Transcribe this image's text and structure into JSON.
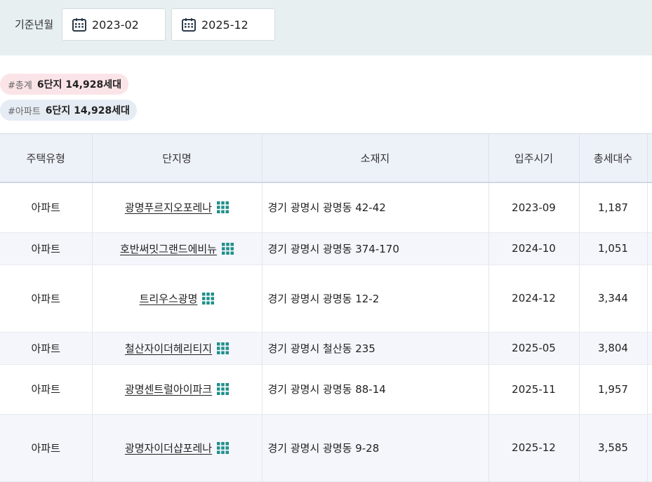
{
  "filter": {
    "label": "기준년월",
    "from": "2023-02",
    "to": "2025-12",
    "icon": "calendar-icon"
  },
  "tags": [
    {
      "hash": "#총계",
      "count": "6단지 14,928세대",
      "color": "#fbe4e7"
    },
    {
      "hash": "#아파트",
      "count": "6단지 14,928세대",
      "color": "#e6ecf4"
    }
  ],
  "table": {
    "headers": [
      "주택유형",
      "단지명",
      "소재지",
      "입주시기",
      "총세대수"
    ],
    "rows": [
      {
        "type": "아파트",
        "name": "광명푸르지오포레나",
        "address": "경기 광명시 광명동 42-42",
        "move_in": "2023-09",
        "households": "1,187"
      },
      {
        "type": "아파트",
        "name": "호반써밋그랜드에비뉴",
        "address": "경기 광명시 광명동 374-170",
        "move_in": "2024-10",
        "households": "1,051"
      },
      {
        "type": "아파트",
        "name": "트리우스광명",
        "address": "경기 광명시 광명동 12-2",
        "move_in": "2024-12",
        "households": "3,344"
      },
      {
        "type": "아파트",
        "name": "철산자이더헤리티지",
        "address": "경기 광명시 철산동 235",
        "move_in": "2025-05",
        "households": "3,804"
      },
      {
        "type": "아파트",
        "name": "광명센트럴아이파크",
        "address": "경기 광명시 광명동 88-14",
        "move_in": "2025-11",
        "households": "1,957"
      },
      {
        "type": "아파트",
        "name": "광명자이더샵포레나",
        "address": "경기 광명시 광명동 9-28",
        "move_in": "2025-12",
        "households": "3,585"
      }
    ]
  },
  "colors": {
    "filter_bg": "#e7eff0",
    "header_bg": "#edf1f8",
    "alt_row_bg": "#f4f6fb",
    "grid_icon": "#1f8f8a"
  }
}
